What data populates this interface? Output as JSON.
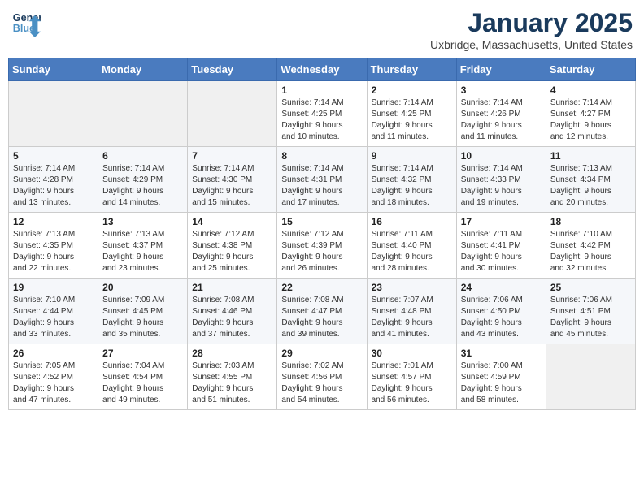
{
  "header": {
    "logo_line1": "General",
    "logo_line2": "Blue",
    "month": "January 2025",
    "location": "Uxbridge, Massachusetts, United States"
  },
  "weekdays": [
    "Sunday",
    "Monday",
    "Tuesday",
    "Wednesday",
    "Thursday",
    "Friday",
    "Saturday"
  ],
  "weeks": [
    [
      {
        "day": "",
        "info": ""
      },
      {
        "day": "",
        "info": ""
      },
      {
        "day": "",
        "info": ""
      },
      {
        "day": "1",
        "info": "Sunrise: 7:14 AM\nSunset: 4:25 PM\nDaylight: 9 hours\nand 10 minutes."
      },
      {
        "day": "2",
        "info": "Sunrise: 7:14 AM\nSunset: 4:25 PM\nDaylight: 9 hours\nand 11 minutes."
      },
      {
        "day": "3",
        "info": "Sunrise: 7:14 AM\nSunset: 4:26 PM\nDaylight: 9 hours\nand 11 minutes."
      },
      {
        "day": "4",
        "info": "Sunrise: 7:14 AM\nSunset: 4:27 PM\nDaylight: 9 hours\nand 12 minutes."
      }
    ],
    [
      {
        "day": "5",
        "info": "Sunrise: 7:14 AM\nSunset: 4:28 PM\nDaylight: 9 hours\nand 13 minutes."
      },
      {
        "day": "6",
        "info": "Sunrise: 7:14 AM\nSunset: 4:29 PM\nDaylight: 9 hours\nand 14 minutes."
      },
      {
        "day": "7",
        "info": "Sunrise: 7:14 AM\nSunset: 4:30 PM\nDaylight: 9 hours\nand 15 minutes."
      },
      {
        "day": "8",
        "info": "Sunrise: 7:14 AM\nSunset: 4:31 PM\nDaylight: 9 hours\nand 17 minutes."
      },
      {
        "day": "9",
        "info": "Sunrise: 7:14 AM\nSunset: 4:32 PM\nDaylight: 9 hours\nand 18 minutes."
      },
      {
        "day": "10",
        "info": "Sunrise: 7:14 AM\nSunset: 4:33 PM\nDaylight: 9 hours\nand 19 minutes."
      },
      {
        "day": "11",
        "info": "Sunrise: 7:13 AM\nSunset: 4:34 PM\nDaylight: 9 hours\nand 20 minutes."
      }
    ],
    [
      {
        "day": "12",
        "info": "Sunrise: 7:13 AM\nSunset: 4:35 PM\nDaylight: 9 hours\nand 22 minutes."
      },
      {
        "day": "13",
        "info": "Sunrise: 7:13 AM\nSunset: 4:37 PM\nDaylight: 9 hours\nand 23 minutes."
      },
      {
        "day": "14",
        "info": "Sunrise: 7:12 AM\nSunset: 4:38 PM\nDaylight: 9 hours\nand 25 minutes."
      },
      {
        "day": "15",
        "info": "Sunrise: 7:12 AM\nSunset: 4:39 PM\nDaylight: 9 hours\nand 26 minutes."
      },
      {
        "day": "16",
        "info": "Sunrise: 7:11 AM\nSunset: 4:40 PM\nDaylight: 9 hours\nand 28 minutes."
      },
      {
        "day": "17",
        "info": "Sunrise: 7:11 AM\nSunset: 4:41 PM\nDaylight: 9 hours\nand 30 minutes."
      },
      {
        "day": "18",
        "info": "Sunrise: 7:10 AM\nSunset: 4:42 PM\nDaylight: 9 hours\nand 32 minutes."
      }
    ],
    [
      {
        "day": "19",
        "info": "Sunrise: 7:10 AM\nSunset: 4:44 PM\nDaylight: 9 hours\nand 33 minutes."
      },
      {
        "day": "20",
        "info": "Sunrise: 7:09 AM\nSunset: 4:45 PM\nDaylight: 9 hours\nand 35 minutes."
      },
      {
        "day": "21",
        "info": "Sunrise: 7:08 AM\nSunset: 4:46 PM\nDaylight: 9 hours\nand 37 minutes."
      },
      {
        "day": "22",
        "info": "Sunrise: 7:08 AM\nSunset: 4:47 PM\nDaylight: 9 hours\nand 39 minutes."
      },
      {
        "day": "23",
        "info": "Sunrise: 7:07 AM\nSunset: 4:48 PM\nDaylight: 9 hours\nand 41 minutes."
      },
      {
        "day": "24",
        "info": "Sunrise: 7:06 AM\nSunset: 4:50 PM\nDaylight: 9 hours\nand 43 minutes."
      },
      {
        "day": "25",
        "info": "Sunrise: 7:06 AM\nSunset: 4:51 PM\nDaylight: 9 hours\nand 45 minutes."
      }
    ],
    [
      {
        "day": "26",
        "info": "Sunrise: 7:05 AM\nSunset: 4:52 PM\nDaylight: 9 hours\nand 47 minutes."
      },
      {
        "day": "27",
        "info": "Sunrise: 7:04 AM\nSunset: 4:54 PM\nDaylight: 9 hours\nand 49 minutes."
      },
      {
        "day": "28",
        "info": "Sunrise: 7:03 AM\nSunset: 4:55 PM\nDaylight: 9 hours\nand 51 minutes."
      },
      {
        "day": "29",
        "info": "Sunrise: 7:02 AM\nSunset: 4:56 PM\nDaylight: 9 hours\nand 54 minutes."
      },
      {
        "day": "30",
        "info": "Sunrise: 7:01 AM\nSunset: 4:57 PM\nDaylight: 9 hours\nand 56 minutes."
      },
      {
        "day": "31",
        "info": "Sunrise: 7:00 AM\nSunset: 4:59 PM\nDaylight: 9 hours\nand 58 minutes."
      },
      {
        "day": "",
        "info": ""
      }
    ]
  ]
}
